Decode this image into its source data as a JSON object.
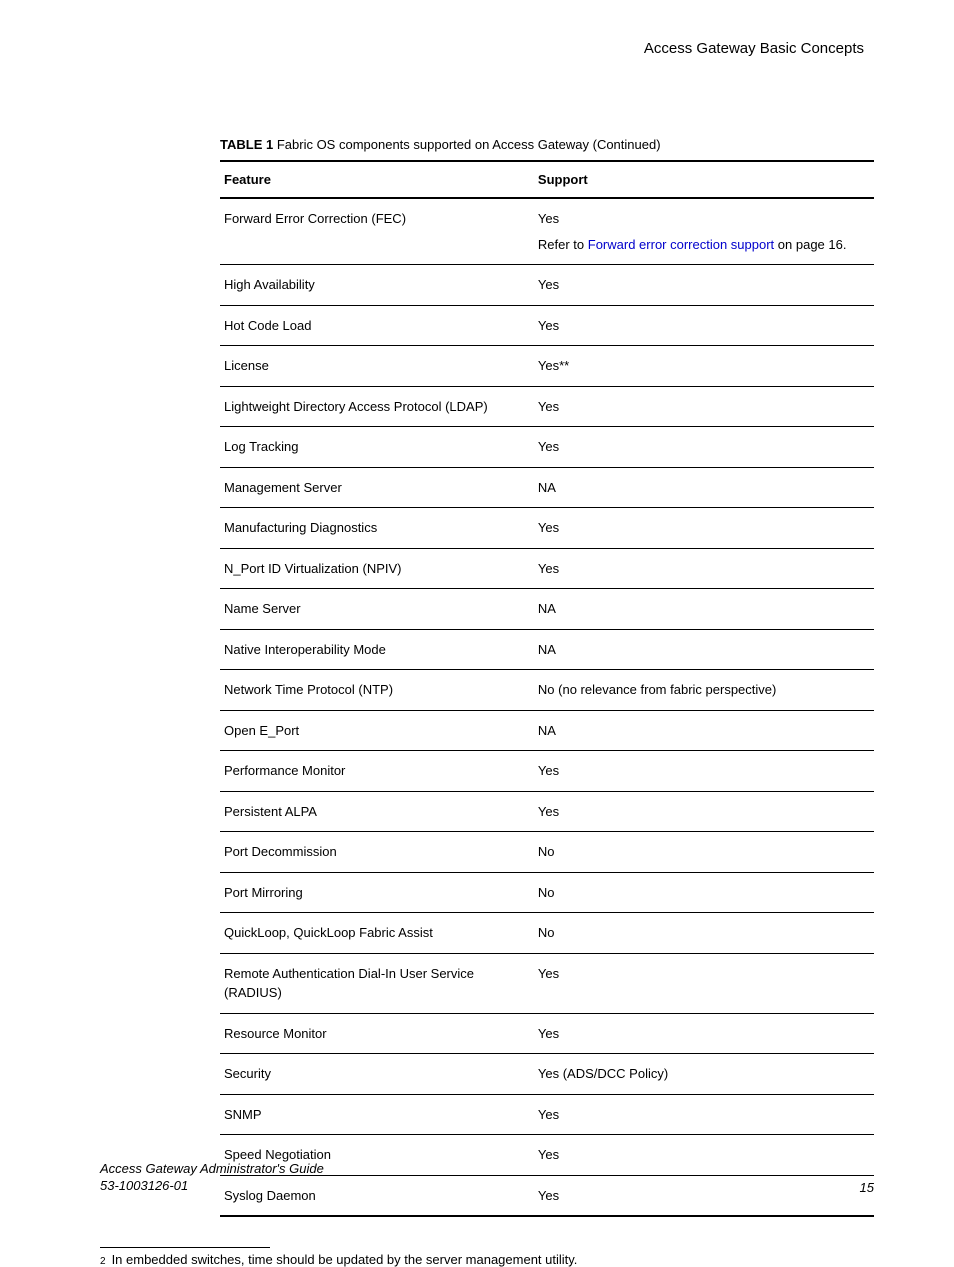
{
  "header": {
    "title": "Access Gateway Basic Concepts"
  },
  "table": {
    "caption_label": "TABLE 1",
    "caption_text": "Fabric OS components supported on Access Gateway (Continued)",
    "col1": "Feature",
    "col2": "Support",
    "rows": [
      {
        "feature": "Forward Error Correction (FEC)",
        "support": "Yes",
        "note_prefix": "Refer to ",
        "note_link": "Forward error correction support",
        "note_suffix": " on page 16."
      },
      {
        "feature": "High Availability",
        "support": "Yes"
      },
      {
        "feature": "Hot Code Load",
        "support": "Yes"
      },
      {
        "feature": "License",
        "support": "Yes**"
      },
      {
        "feature": "Lightweight Directory Access Protocol (LDAP)",
        "support": "Yes"
      },
      {
        "feature": "Log Tracking",
        "support": "Yes"
      },
      {
        "feature": "Management Server",
        "support": "NA"
      },
      {
        "feature": "Manufacturing Diagnostics",
        "support": "Yes"
      },
      {
        "feature": "N_Port ID Virtualization (NPIV)",
        "support": "Yes"
      },
      {
        "feature": "Name Server",
        "support": "NA"
      },
      {
        "feature": "Native Interoperability Mode",
        "support": "NA"
      },
      {
        "feature": "Network Time Protocol (NTP)",
        "support": "No (no relevance from fabric perspective)"
      },
      {
        "feature": "Open E_Port",
        "support": "NA"
      },
      {
        "feature": "Performance Monitor",
        "support": "Yes"
      },
      {
        "feature": "Persistent ALPA",
        "support": "Yes"
      },
      {
        "feature": "Port Decommission",
        "support": "No"
      },
      {
        "feature": "Port Mirroring",
        "support": "No"
      },
      {
        "feature": "QuickLoop, QuickLoop Fabric Assist",
        "support": "No"
      },
      {
        "feature": "Remote Authentication Dial-In User Service (RADIUS)",
        "support": "Yes"
      },
      {
        "feature": "Resource Monitor",
        "support": "Yes"
      },
      {
        "feature": "Security",
        "support": "Yes (ADS/DCC Policy)"
      },
      {
        "feature": "SNMP",
        "support": "Yes"
      },
      {
        "feature": "Speed Negotiation",
        "support": "Yes"
      },
      {
        "feature": "Syslog Daemon",
        "support": "Yes"
      }
    ]
  },
  "footnote": {
    "num": "2",
    "text": "In embedded switches, time should be updated by the server management utility."
  },
  "footer": {
    "doc_title": "Access Gateway Administrator's Guide",
    "doc_num": "53-1003126-01",
    "page": "15"
  }
}
